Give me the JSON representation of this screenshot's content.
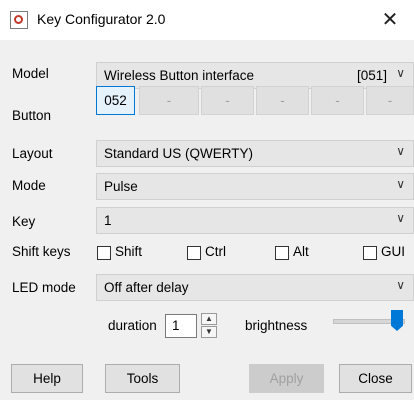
{
  "window": {
    "title": "Key Configurator 2.0"
  },
  "model": {
    "label": "Model",
    "value": "Wireless Button interface",
    "code": "[051]"
  },
  "button": {
    "label": "Button",
    "cells": [
      "052",
      "-",
      "-",
      "-",
      "-",
      "-"
    ]
  },
  "layout": {
    "label": "Layout",
    "value": "Standard US (QWERTY)"
  },
  "mode": {
    "label": "Mode",
    "value": "Pulse"
  },
  "key": {
    "label": "Key",
    "value": "1"
  },
  "shift_keys": {
    "label": "Shift keys",
    "options": [
      "Shift",
      "Ctrl",
      "Alt",
      "GUI"
    ]
  },
  "led_mode": {
    "label": "LED mode",
    "value": "Off after delay"
  },
  "duration": {
    "label": "duration",
    "value": "1"
  },
  "brightness": {
    "label": "brightness",
    "level": 1.0
  },
  "footer": {
    "help": "Help",
    "tools": "Tools",
    "apply": "Apply",
    "close": "Close"
  },
  "colors": {
    "accent": "#0078d7",
    "panel": "#f0f0f0"
  },
  "icons": {
    "window_close": "close-icon",
    "dropdown": "chevron-down-icon"
  }
}
